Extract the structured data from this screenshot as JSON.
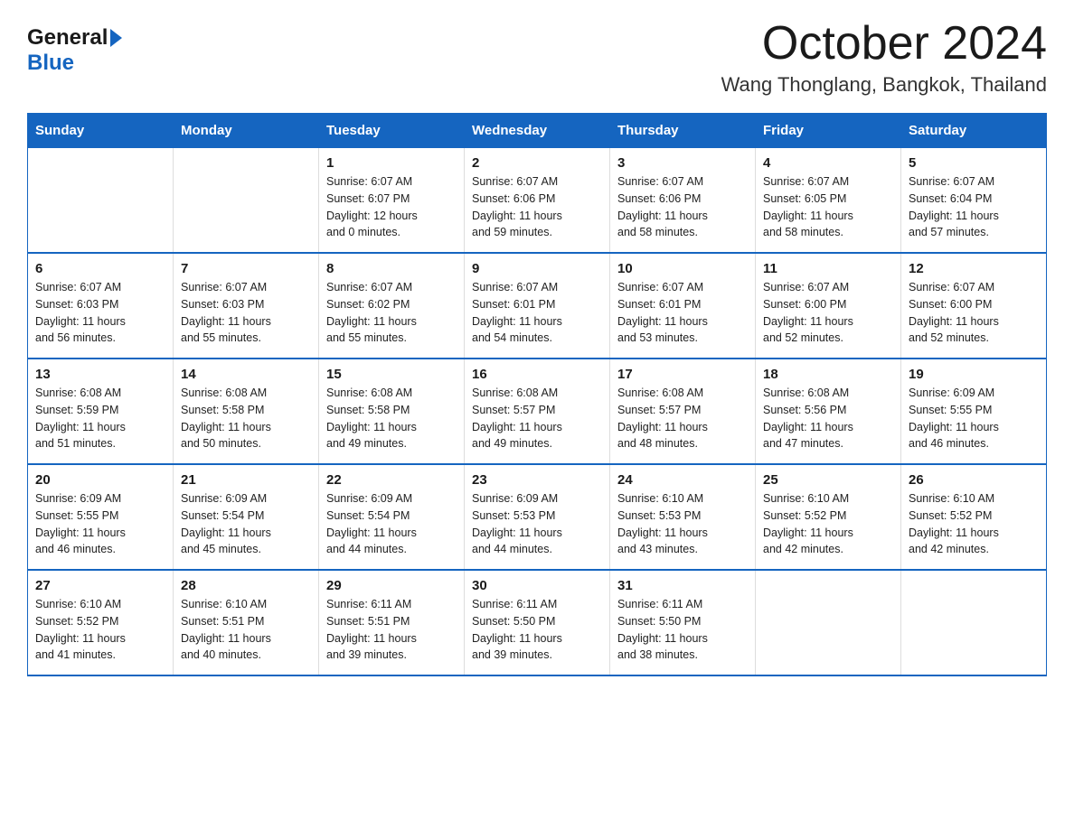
{
  "header": {
    "title": "October 2024",
    "subtitle": "Wang Thonglang, Bangkok, Thailand",
    "logo_general": "General",
    "logo_blue": "Blue"
  },
  "weekdays": [
    "Sunday",
    "Monday",
    "Tuesday",
    "Wednesday",
    "Thursday",
    "Friday",
    "Saturday"
  ],
  "weeks": [
    [
      {
        "day": "",
        "info": ""
      },
      {
        "day": "",
        "info": ""
      },
      {
        "day": "1",
        "info": "Sunrise: 6:07 AM\nSunset: 6:07 PM\nDaylight: 12 hours\nand 0 minutes."
      },
      {
        "day": "2",
        "info": "Sunrise: 6:07 AM\nSunset: 6:06 PM\nDaylight: 11 hours\nand 59 minutes."
      },
      {
        "day": "3",
        "info": "Sunrise: 6:07 AM\nSunset: 6:06 PM\nDaylight: 11 hours\nand 58 minutes."
      },
      {
        "day": "4",
        "info": "Sunrise: 6:07 AM\nSunset: 6:05 PM\nDaylight: 11 hours\nand 58 minutes."
      },
      {
        "day": "5",
        "info": "Sunrise: 6:07 AM\nSunset: 6:04 PM\nDaylight: 11 hours\nand 57 minutes."
      }
    ],
    [
      {
        "day": "6",
        "info": "Sunrise: 6:07 AM\nSunset: 6:03 PM\nDaylight: 11 hours\nand 56 minutes."
      },
      {
        "day": "7",
        "info": "Sunrise: 6:07 AM\nSunset: 6:03 PM\nDaylight: 11 hours\nand 55 minutes."
      },
      {
        "day": "8",
        "info": "Sunrise: 6:07 AM\nSunset: 6:02 PM\nDaylight: 11 hours\nand 55 minutes."
      },
      {
        "day": "9",
        "info": "Sunrise: 6:07 AM\nSunset: 6:01 PM\nDaylight: 11 hours\nand 54 minutes."
      },
      {
        "day": "10",
        "info": "Sunrise: 6:07 AM\nSunset: 6:01 PM\nDaylight: 11 hours\nand 53 minutes."
      },
      {
        "day": "11",
        "info": "Sunrise: 6:07 AM\nSunset: 6:00 PM\nDaylight: 11 hours\nand 52 minutes."
      },
      {
        "day": "12",
        "info": "Sunrise: 6:07 AM\nSunset: 6:00 PM\nDaylight: 11 hours\nand 52 minutes."
      }
    ],
    [
      {
        "day": "13",
        "info": "Sunrise: 6:08 AM\nSunset: 5:59 PM\nDaylight: 11 hours\nand 51 minutes."
      },
      {
        "day": "14",
        "info": "Sunrise: 6:08 AM\nSunset: 5:58 PM\nDaylight: 11 hours\nand 50 minutes."
      },
      {
        "day": "15",
        "info": "Sunrise: 6:08 AM\nSunset: 5:58 PM\nDaylight: 11 hours\nand 49 minutes."
      },
      {
        "day": "16",
        "info": "Sunrise: 6:08 AM\nSunset: 5:57 PM\nDaylight: 11 hours\nand 49 minutes."
      },
      {
        "day": "17",
        "info": "Sunrise: 6:08 AM\nSunset: 5:57 PM\nDaylight: 11 hours\nand 48 minutes."
      },
      {
        "day": "18",
        "info": "Sunrise: 6:08 AM\nSunset: 5:56 PM\nDaylight: 11 hours\nand 47 minutes."
      },
      {
        "day": "19",
        "info": "Sunrise: 6:09 AM\nSunset: 5:55 PM\nDaylight: 11 hours\nand 46 minutes."
      }
    ],
    [
      {
        "day": "20",
        "info": "Sunrise: 6:09 AM\nSunset: 5:55 PM\nDaylight: 11 hours\nand 46 minutes."
      },
      {
        "day": "21",
        "info": "Sunrise: 6:09 AM\nSunset: 5:54 PM\nDaylight: 11 hours\nand 45 minutes."
      },
      {
        "day": "22",
        "info": "Sunrise: 6:09 AM\nSunset: 5:54 PM\nDaylight: 11 hours\nand 44 minutes."
      },
      {
        "day": "23",
        "info": "Sunrise: 6:09 AM\nSunset: 5:53 PM\nDaylight: 11 hours\nand 44 minutes."
      },
      {
        "day": "24",
        "info": "Sunrise: 6:10 AM\nSunset: 5:53 PM\nDaylight: 11 hours\nand 43 minutes."
      },
      {
        "day": "25",
        "info": "Sunrise: 6:10 AM\nSunset: 5:52 PM\nDaylight: 11 hours\nand 42 minutes."
      },
      {
        "day": "26",
        "info": "Sunrise: 6:10 AM\nSunset: 5:52 PM\nDaylight: 11 hours\nand 42 minutes."
      }
    ],
    [
      {
        "day": "27",
        "info": "Sunrise: 6:10 AM\nSunset: 5:52 PM\nDaylight: 11 hours\nand 41 minutes."
      },
      {
        "day": "28",
        "info": "Sunrise: 6:10 AM\nSunset: 5:51 PM\nDaylight: 11 hours\nand 40 minutes."
      },
      {
        "day": "29",
        "info": "Sunrise: 6:11 AM\nSunset: 5:51 PM\nDaylight: 11 hours\nand 39 minutes."
      },
      {
        "day": "30",
        "info": "Sunrise: 6:11 AM\nSunset: 5:50 PM\nDaylight: 11 hours\nand 39 minutes."
      },
      {
        "day": "31",
        "info": "Sunrise: 6:11 AM\nSunset: 5:50 PM\nDaylight: 11 hours\nand 38 minutes."
      },
      {
        "day": "",
        "info": ""
      },
      {
        "day": "",
        "info": ""
      }
    ]
  ]
}
